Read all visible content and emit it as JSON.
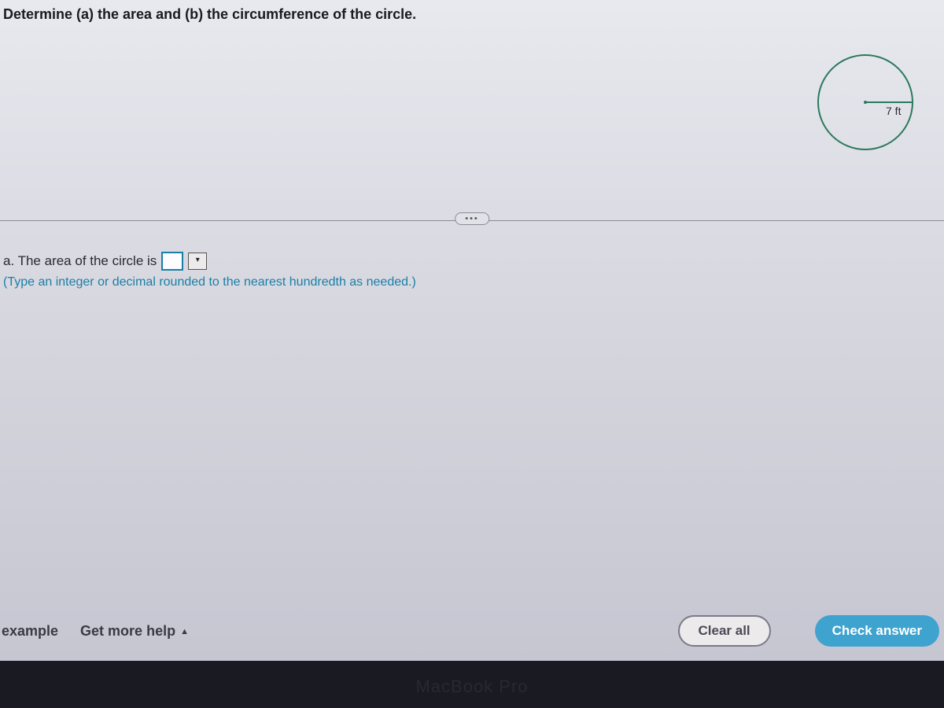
{
  "question": {
    "prompt": "Determine (a) the area and (b) the circumference of the circle.",
    "diagram_label": "7 ft"
  },
  "divider": {
    "pill": "•••"
  },
  "part_a": {
    "prefix": "a. The area of the circle is",
    "hint": "(Type an integer or decimal rounded to the nearest hundredth as needed.)"
  },
  "footer": {
    "example": "example",
    "get_more_help": "Get more help",
    "clear_all": "Clear all",
    "check_answer": "Check answer"
  },
  "branding": "MacBook Pro"
}
